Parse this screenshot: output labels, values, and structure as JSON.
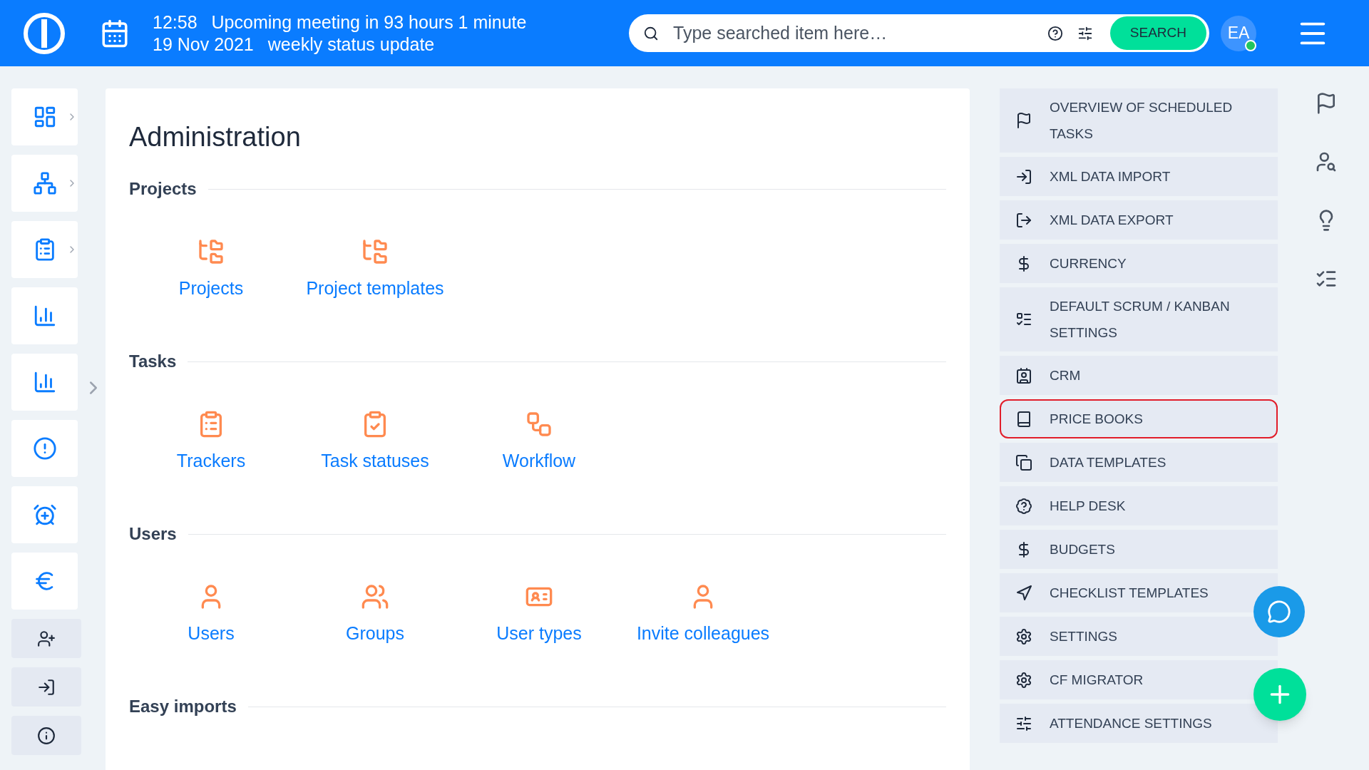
{
  "header": {
    "time": "12:58",
    "meeting": "Upcoming meeting in 93 hours 1 minute",
    "date": "19 Nov 2021",
    "meeting_title": "weekly status update",
    "search": {
      "placeholder": "Type searched item here…",
      "button": "SEARCH"
    },
    "avatar": "EA"
  },
  "sidebar": {
    "items": [
      {
        "kind": "tile",
        "expandable": true
      },
      {
        "kind": "tile",
        "expandable": true
      },
      {
        "kind": "tile",
        "expandable": true
      },
      {
        "kind": "tile",
        "expandable": false
      },
      {
        "kind": "tile",
        "expandable": false
      },
      {
        "kind": "tile",
        "expandable": false
      },
      {
        "kind": "tile",
        "expandable": false
      },
      {
        "kind": "tile",
        "expandable": false
      },
      {
        "kind": "small",
        "expandable": false
      },
      {
        "kind": "small",
        "expandable": false
      },
      {
        "kind": "small",
        "expandable": false
      }
    ]
  },
  "page": {
    "title": "Administration",
    "sections": [
      {
        "title": "Projects",
        "items": [
          "Projects",
          "Project templates"
        ]
      },
      {
        "title": "Tasks",
        "items": [
          "Trackers",
          "Task statuses",
          "Workflow"
        ]
      },
      {
        "title": "Users",
        "items": [
          "Users",
          "Groups",
          "User types",
          "Invite colleagues"
        ]
      },
      {
        "title": "Easy imports"
      }
    ]
  },
  "settings_menu": {
    "items": [
      {
        "label": "OVERVIEW OF SCHEDULED TASKS",
        "highlighted": false
      },
      {
        "label": "XML DATA IMPORT",
        "highlighted": false
      },
      {
        "label": "XML DATA EXPORT",
        "highlighted": false
      },
      {
        "label": "CURRENCY",
        "highlighted": false
      },
      {
        "label": "DEFAULT SCRUM / KANBAN SETTINGS",
        "highlighted": false
      },
      {
        "label": "CRM",
        "highlighted": false
      },
      {
        "label": "PRICE BOOKS",
        "highlighted": true
      },
      {
        "label": "DATA TEMPLATES",
        "highlighted": false
      },
      {
        "label": "HELP DESK",
        "highlighted": false
      },
      {
        "label": "BUDGETS",
        "highlighted": false
      },
      {
        "label": "CHECKLIST TEMPLATES",
        "highlighted": false
      },
      {
        "label": "SETTINGS",
        "highlighted": false
      },
      {
        "label": "CF MIGRATOR",
        "highlighted": false
      },
      {
        "label": "ATTENDANCE SETTINGS",
        "highlighted": false
      }
    ]
  }
}
